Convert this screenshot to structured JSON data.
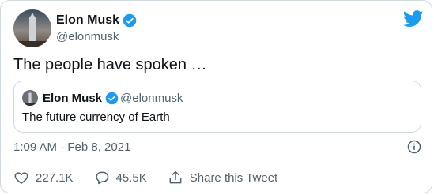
{
  "author": {
    "name": "Elon Musk",
    "handle": "@elonmusk"
  },
  "tweet": {
    "text": "The people have spoken …",
    "timestamp": "1:09 AM · Feb 8, 2021"
  },
  "quoted": {
    "name": "Elon Musk",
    "handle": "@elonmusk",
    "text": "The future currency of Earth"
  },
  "actions": {
    "likes": "227.1K",
    "replies": "45.5K",
    "share_label": "Share this Tweet"
  },
  "colors": {
    "brand": "#1d9bf0",
    "text_primary": "#0f1419",
    "text_secondary": "#536471",
    "border": "#cfd9de"
  },
  "icons": [
    "avatar",
    "verified-badge-icon",
    "twitter-bird-icon",
    "info-icon",
    "heart-icon",
    "reply-icon",
    "share-icon"
  ]
}
